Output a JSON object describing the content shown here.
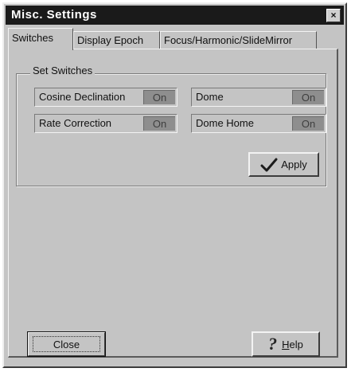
{
  "window": {
    "title": "Misc. Settings",
    "close_glyph": "×"
  },
  "tabs": [
    {
      "label": "Switches",
      "active": true
    },
    {
      "label": "Display Epoch",
      "active": false
    },
    {
      "label": "Focus/Harmonic/SlideMirror",
      "active": false
    }
  ],
  "switches_group": {
    "label": "Set Switches",
    "items": [
      {
        "label": "Cosine Declination",
        "state": "On"
      },
      {
        "label": "Dome",
        "state": "On"
      },
      {
        "label": "Rate Correction",
        "state": "On"
      },
      {
        "label": "Dome Home",
        "state": "On"
      }
    ]
  },
  "buttons": {
    "apply": {
      "label": "Apply",
      "icon": "checkmark-icon"
    },
    "close": {
      "label": "Close"
    },
    "help": {
      "label": "Help",
      "icon": "question-mark-icon"
    }
  }
}
